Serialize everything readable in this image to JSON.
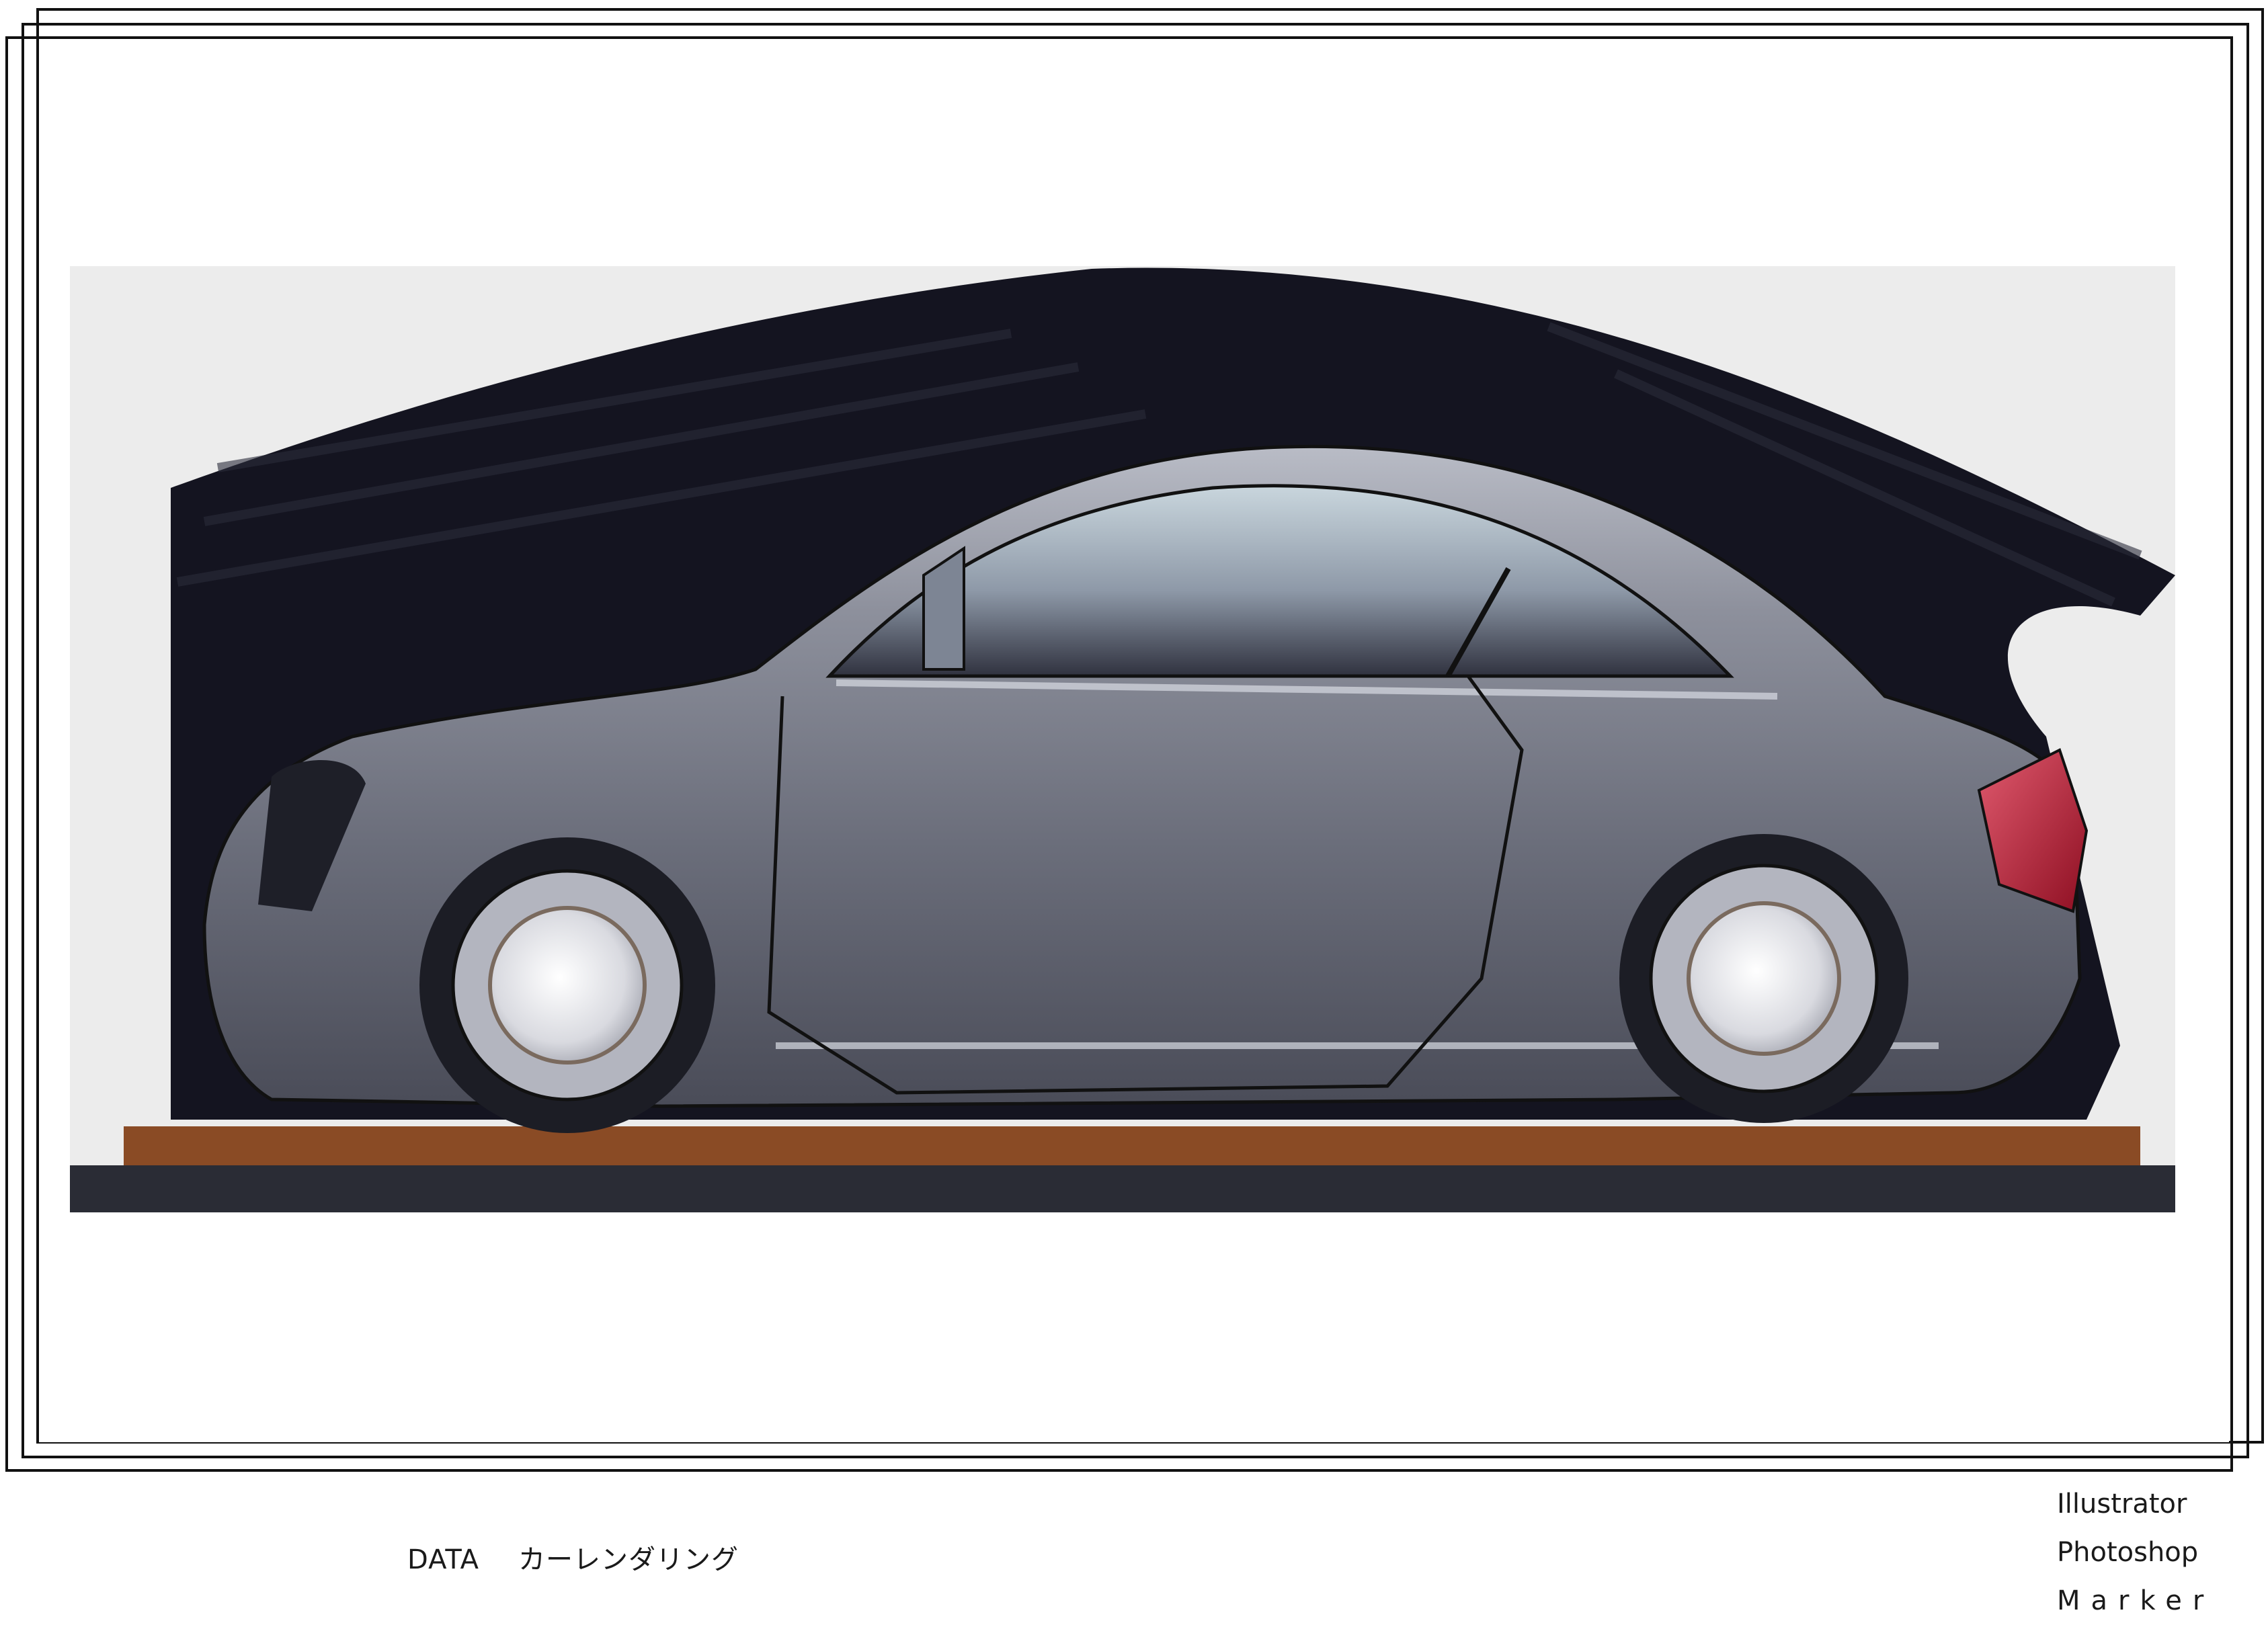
{
  "caption": {
    "label": "DATA",
    "title": "カーレンダリング"
  },
  "tools": [
    "Illustrator",
    "Photoshop",
    "Marker"
  ],
  "colors": {
    "background": "#ffffff",
    "frame_lines": "#111111",
    "paper": "#ececec",
    "backdrop_marker": "#141420",
    "car_body": "#7c7e89",
    "ground_brown": "#8a4b25",
    "ground_dark": "#2a2c35",
    "tail_light": "#a8132b"
  },
  "artwork": {
    "subject": "car-side-view-marker-rendering"
  }
}
